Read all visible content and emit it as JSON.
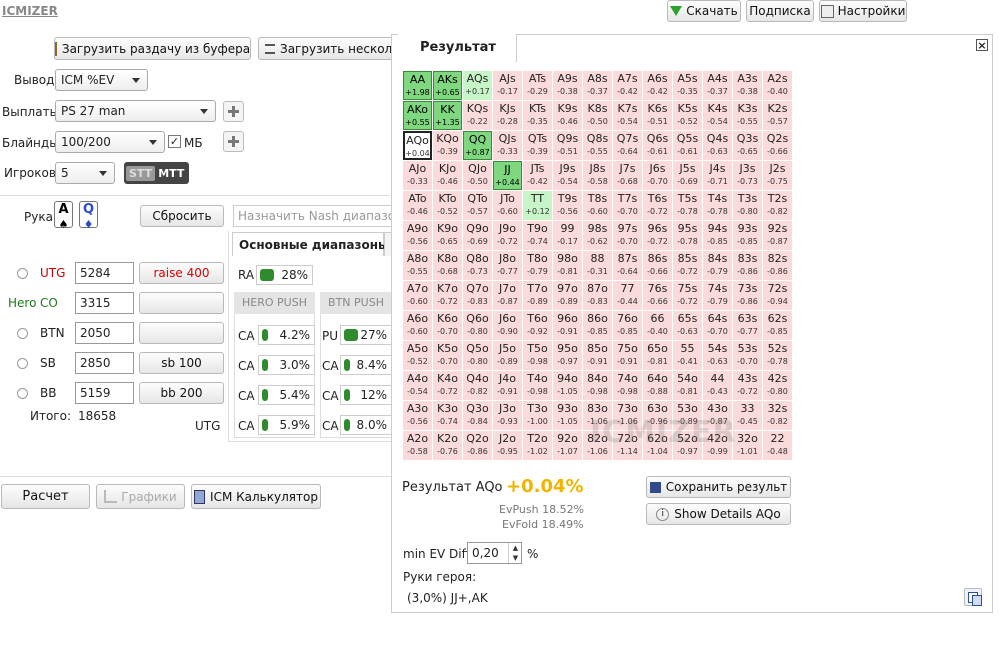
{
  "app": {
    "logo": "ICMIZER"
  },
  "topbar": {
    "download": "Скачать",
    "subscribe": "Подписка",
    "settings": "Настройки"
  },
  "toolbar": {
    "load_clipboard": "Загрузить раздачу из буфера",
    "load_many": "Загрузить нескол"
  },
  "form": {
    "output_label": "Вывод",
    "output_value": "ICM %EV",
    "payouts_label": "Выплаты",
    "payouts_value": "PS 27 man",
    "blinds_label": "Блайнды",
    "blinds_value": "100/200",
    "mb_label": "МБ",
    "players_label": "Игроков",
    "players_value": "5",
    "stt": "STT",
    "mtt": "MTT"
  },
  "hand": {
    "label": "Рука",
    "card1": "A",
    "card1_suit": "♠",
    "card2": "Q",
    "card2_suit": "♦",
    "reset": "Сбросить",
    "nash_placeholder": "Назначить Nash диапазоны"
  },
  "players": [
    {
      "name": "UTG",
      "stack": "5284",
      "action": "raise 400"
    },
    {
      "hero": "Hero",
      "name": "CO",
      "stack": "3315",
      "action": ""
    },
    {
      "name": "BTN",
      "stack": "2050",
      "action": ""
    },
    {
      "name": "SB",
      "stack": "2850",
      "action": "sb 100"
    },
    {
      "name": "BB",
      "stack": "5159",
      "action": "bb 200"
    }
  ],
  "total": {
    "label": "Итого:",
    "value": "18658",
    "utg": "UTG"
  },
  "ranges": {
    "tab": "Основные диапазоны",
    "ra_label": "RA",
    "ra_value": "28%",
    "hero_push": "HERO PUSH",
    "btn_push": "BTN PUSH",
    "hero_rows": [
      {
        "l": "CA",
        "v": "4.2%"
      },
      {
        "l": "CA",
        "v": "3.0%"
      },
      {
        "l": "CA",
        "v": "5.4%"
      },
      {
        "l": "CA",
        "v": "5.9%"
      }
    ],
    "btn_rows": [
      {
        "l": "PU",
        "v": "27%"
      },
      {
        "l": "CA",
        "v": "8.4%"
      },
      {
        "l": "CA",
        "v": "12%"
      },
      {
        "l": "CA",
        "v": "8.0%"
      }
    ]
  },
  "bottom": {
    "calc": "Расчет",
    "graphs": "Графики",
    "icm_calc": "ICM Калькулятор"
  },
  "result": {
    "title": "Результат",
    "summary_label": "Результат AQo",
    "summary_value": "+0.04%",
    "ev_push": "EvPush 18.52%",
    "ev_fold": "EvFold 18.49%",
    "save": "Сохранить результ",
    "details": "Show Details AQo",
    "min_ev_label": "min EV Diff",
    "min_ev_value": "0,20",
    "pct": "%",
    "hero_hands_label": "Руки героя:",
    "hero_hands_value": "(3,0%) JJ+,AK",
    "watermark": "ICMIZER",
    "grid": [
      [
        [
          "AA",
          "+1.98"
        ],
        [
          "AKs",
          "+0.65"
        ],
        [
          "AQs",
          "+0.17"
        ],
        [
          "AJs",
          "-0.17"
        ],
        [
          "ATs",
          "-0.29"
        ],
        [
          "A9s",
          "-0.38"
        ],
        [
          "A8s",
          "-0.37"
        ],
        [
          "A7s",
          "-0.42"
        ],
        [
          "A6s",
          "-0.42"
        ],
        [
          "A5s",
          "-0.35"
        ],
        [
          "A4s",
          "-0.37"
        ],
        [
          "A3s",
          "-0.38"
        ],
        [
          "A2s",
          "-0.40"
        ]
      ],
      [
        [
          "AKo",
          "+0.55"
        ],
        [
          "KK",
          "+1.35"
        ],
        [
          "KQs",
          "-0.22"
        ],
        [
          "KJs",
          "-0.28"
        ],
        [
          "KTs",
          "-0.35"
        ],
        [
          "K9s",
          "-0.46"
        ],
        [
          "K8s",
          "-0.50"
        ],
        [
          "K7s",
          "-0.54"
        ],
        [
          "K6s",
          "-0.51"
        ],
        [
          "K5s",
          "-0.52"
        ],
        [
          "K4s",
          "-0.54"
        ],
        [
          "K3s",
          "-0.55"
        ],
        [
          "K2s",
          "-0.57"
        ]
      ],
      [
        [
          "AQo",
          "+0.04"
        ],
        [
          "KQo",
          "-0.39"
        ],
        [
          "QQ",
          "+0.87"
        ],
        [
          "QJs",
          "-0.33"
        ],
        [
          "QTs",
          "-0.39"
        ],
        [
          "Q9s",
          "-0.51"
        ],
        [
          "Q8s",
          "-0.55"
        ],
        [
          "Q7s",
          "-0.64"
        ],
        [
          "Q6s",
          "-0.61"
        ],
        [
          "Q5s",
          "-0.61"
        ],
        [
          "Q4s",
          "-0.63"
        ],
        [
          "Q3s",
          "-0.65"
        ],
        [
          "Q2s",
          "-0.66"
        ]
      ],
      [
        [
          "AJo",
          "-0.33"
        ],
        [
          "KJo",
          "-0.46"
        ],
        [
          "QJo",
          "-0.50"
        ],
        [
          "JJ",
          "+0.44"
        ],
        [
          "JTs",
          "-0.42"
        ],
        [
          "J9s",
          "-0.54"
        ],
        [
          "J8s",
          "-0.58"
        ],
        [
          "J7s",
          "-0.68"
        ],
        [
          "J6s",
          "-0.70"
        ],
        [
          "J5s",
          "-0.69"
        ],
        [
          "J4s",
          "-0.71"
        ],
        [
          "J3s",
          "-0.73"
        ],
        [
          "J2s",
          "-0.75"
        ]
      ],
      [
        [
          "ATo",
          "-0.46"
        ],
        [
          "KTo",
          "-0.52"
        ],
        [
          "QTo",
          "-0.57"
        ],
        [
          "JTo",
          "-0.60"
        ],
        [
          "TT",
          "+0.12"
        ],
        [
          "T9s",
          "-0.56"
        ],
        [
          "T8s",
          "-0.60"
        ],
        [
          "T7s",
          "-0.70"
        ],
        [
          "T6s",
          "-0.72"
        ],
        [
          "T5s",
          "-0.78"
        ],
        [
          "T4s",
          "-0.78"
        ],
        [
          "T3s",
          "-0.80"
        ],
        [
          "T2s",
          "-0.82"
        ]
      ],
      [
        [
          "A9o",
          "-0.56"
        ],
        [
          "K9o",
          "-0.65"
        ],
        [
          "Q9o",
          "-0.69"
        ],
        [
          "J9o",
          "-0.72"
        ],
        [
          "T9o",
          "-0.74"
        ],
        [
          "99",
          "-0.17"
        ],
        [
          "98s",
          "-0.62"
        ],
        [
          "97s",
          "-0.70"
        ],
        [
          "96s",
          "-0.72"
        ],
        [
          "95s",
          "-0.78"
        ],
        [
          "94s",
          "-0.85"
        ],
        [
          "93s",
          "-0.85"
        ],
        [
          "92s",
          "-0.87"
        ]
      ],
      [
        [
          "A8o",
          "-0.55"
        ],
        [
          "K8o",
          "-0.68"
        ],
        [
          "Q8o",
          "-0.73"
        ],
        [
          "J8o",
          "-0.77"
        ],
        [
          "T8o",
          "-0.79"
        ],
        [
          "98o",
          "-0.81"
        ],
        [
          "88",
          "-0.31"
        ],
        [
          "87s",
          "-0.64"
        ],
        [
          "86s",
          "-0.66"
        ],
        [
          "85s",
          "-0.72"
        ],
        [
          "84s",
          "-0.79"
        ],
        [
          "83s",
          "-0.86"
        ],
        [
          "82s",
          "-0.86"
        ]
      ],
      [
        [
          "A7o",
          "-0.60"
        ],
        [
          "K7o",
          "-0.72"
        ],
        [
          "Q7o",
          "-0.83"
        ],
        [
          "J7o",
          "-0.87"
        ],
        [
          "T7o",
          "-0.89"
        ],
        [
          "97o",
          "-0.89"
        ],
        [
          "87o",
          "-0.83"
        ],
        [
          "77",
          "-0.44"
        ],
        [
          "76s",
          "-0.66"
        ],
        [
          "75s",
          "-0.72"
        ],
        [
          "74s",
          "-0.79"
        ],
        [
          "73s",
          "-0.86"
        ],
        [
          "72s",
          "-0.94"
        ]
      ],
      [
        [
          "A6o",
          "-0.60"
        ],
        [
          "K6o",
          "-0.70"
        ],
        [
          "Q6o",
          "-0.80"
        ],
        [
          "J6o",
          "-0.90"
        ],
        [
          "T6o",
          "-0.92"
        ],
        [
          "96o",
          "-0.91"
        ],
        [
          "86o",
          "-0.85"
        ],
        [
          "76o",
          "-0.85"
        ],
        [
          "66",
          "-0.40"
        ],
        [
          "65s",
          "-0.63"
        ],
        [
          "64s",
          "-0.70"
        ],
        [
          "63s",
          "-0.77"
        ],
        [
          "62s",
          "-0.85"
        ]
      ],
      [
        [
          "A5o",
          "-0.52"
        ],
        [
          "K5o",
          "-0.70"
        ],
        [
          "Q5o",
          "-0.80"
        ],
        [
          "J5o",
          "-0.89"
        ],
        [
          "T5o",
          "-0.98"
        ],
        [
          "95o",
          "-0.97"
        ],
        [
          "85o",
          "-0.91"
        ],
        [
          "75o",
          "-0.91"
        ],
        [
          "65o",
          "-0.81"
        ],
        [
          "55",
          "-0.41"
        ],
        [
          "54s",
          "-0.63"
        ],
        [
          "53s",
          "-0.70"
        ],
        [
          "52s",
          "-0.78"
        ]
      ],
      [
        [
          "A4o",
          "-0.54"
        ],
        [
          "K4o",
          "-0.72"
        ],
        [
          "Q4o",
          "-0.82"
        ],
        [
          "J4o",
          "-0.91"
        ],
        [
          "T4o",
          "-0.98"
        ],
        [
          "94o",
          "-1.05"
        ],
        [
          "84o",
          "-0.98"
        ],
        [
          "74o",
          "-0.98"
        ],
        [
          "64o",
          "-0.88"
        ],
        [
          "54o",
          "-0.81"
        ],
        [
          "44",
          "-0.43"
        ],
        [
          "43s",
          "-0.72"
        ],
        [
          "42s",
          "-0.80"
        ]
      ],
      [
        [
          "A3o",
          "-0.56"
        ],
        [
          "K3o",
          "-0.74"
        ],
        [
          "Q3o",
          "-0.84"
        ],
        [
          "J3o",
          "-0.93"
        ],
        [
          "T3o",
          "-1.00"
        ],
        [
          "93o",
          "-1.05"
        ],
        [
          "83o",
          "-1.06"
        ],
        [
          "73o",
          "-1.06"
        ],
        [
          "63o",
          "-0.96"
        ],
        [
          "53o",
          "-0.89"
        ],
        [
          "43o",
          "-0.87"
        ],
        [
          "33",
          "-0.45"
        ],
        [
          "32s",
          "-0.82"
        ]
      ],
      [
        [
          "A2o",
          "-0.58"
        ],
        [
          "K2o",
          "-0.76"
        ],
        [
          "Q2o",
          "-0.86"
        ],
        [
          "J2o",
          "-0.95"
        ],
        [
          "T2o",
          "-1.02"
        ],
        [
          "92o",
          "-1.07"
        ],
        [
          "82o",
          "-1.06"
        ],
        [
          "72o",
          "-1.14"
        ],
        [
          "62o",
          "-1.04"
        ],
        [
          "52o",
          "-0.97"
        ],
        [
          "42o",
          "-0.99"
        ],
        [
          "32o",
          "-1.01"
        ],
        [
          "22",
          "-0.48"
        ]
      ]
    ]
  }
}
